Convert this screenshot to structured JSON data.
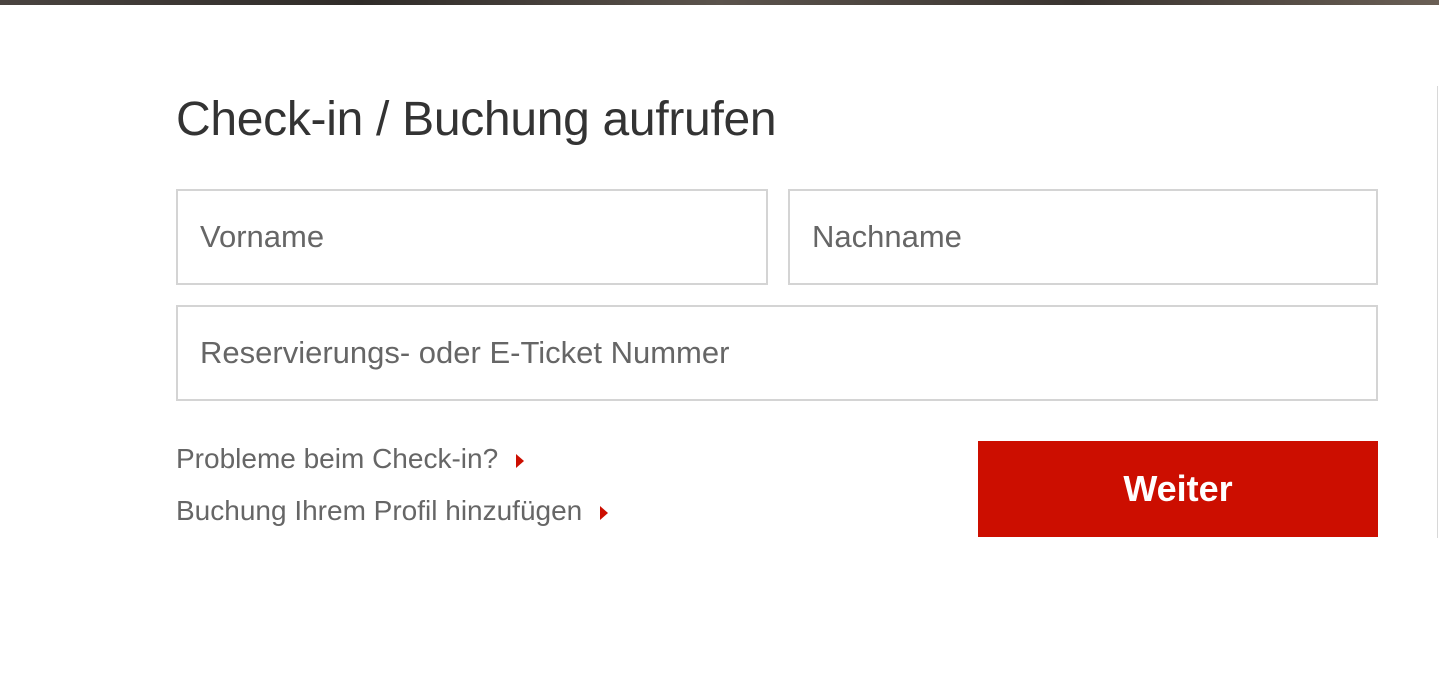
{
  "header": {
    "title": "Check-in / Buchung aufrufen"
  },
  "form": {
    "first_name": {
      "placeholder": "Vorname",
      "value": ""
    },
    "last_name": {
      "placeholder": "Nachname",
      "value": ""
    },
    "reservation": {
      "placeholder": "Reservierungs- oder E-Ticket Nummer",
      "value": ""
    },
    "submit_label": "Weiter"
  },
  "links": {
    "problems": "Probleme beim Check-in?",
    "add_to_profile": "Buchung Ihrem Profil hinzufügen"
  },
  "icons": {
    "link_arrow": "caret-right-icon"
  },
  "colors": {
    "accent": "#cc0e00",
    "title_text": "#333333",
    "secondary_text": "#666666",
    "field_border": "#d4d4d4"
  }
}
